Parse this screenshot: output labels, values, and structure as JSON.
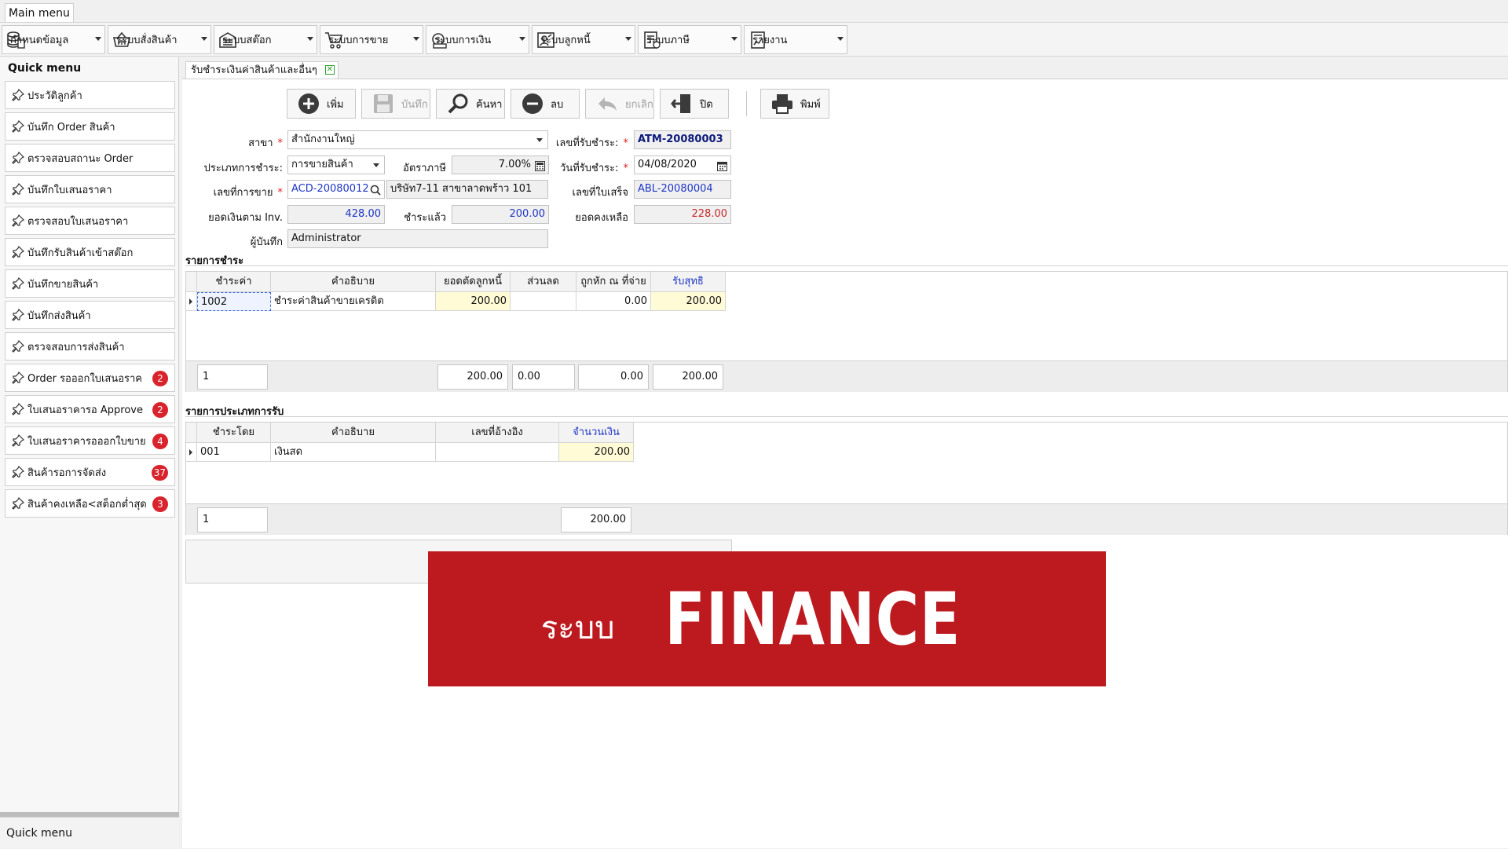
{
  "window": {
    "main_menu_tab": "Main menu"
  },
  "menubar": {
    "items": [
      {
        "label": "กำหนดข้อมูล",
        "icon": "database-icon"
      },
      {
        "label": "ระบบสั่งสินค้า",
        "icon": "basket-icon"
      },
      {
        "label": "ระบบสต๊อก",
        "icon": "warehouse-icon"
      },
      {
        "label": "ระบบการขาย",
        "icon": "cart-icon"
      },
      {
        "label": "ระบบการเงิน",
        "icon": "money-icon"
      },
      {
        "label": "ระบบลูกหนี้",
        "icon": "debtor-icon"
      },
      {
        "label": "ระบบภาษี",
        "icon": "tax-icon"
      },
      {
        "label": "รายงาน",
        "icon": "report-icon"
      }
    ]
  },
  "sidebar": {
    "title": "Quick menu",
    "footer": "Quick menu",
    "items": [
      {
        "label": "ประวัติลูกค้า",
        "badge": ""
      },
      {
        "label": "บันทึก Order สินค้า",
        "badge": ""
      },
      {
        "label": "ตรวจสอบสถานะ Order",
        "badge": ""
      },
      {
        "label": "บันทึกใบเสนอราคา",
        "badge": ""
      },
      {
        "label": "ตรวจสอบใบเสนอราคา",
        "badge": ""
      },
      {
        "label": "บันทึกรับสินค้าเข้าสต๊อก",
        "badge": ""
      },
      {
        "label": "บันทึกขายสินค้า",
        "badge": ""
      },
      {
        "label": "บันทึกส่งสินค้า",
        "badge": ""
      },
      {
        "label": "ตรวจสอบการส่งสินค้า",
        "badge": ""
      },
      {
        "label": "Order รอออกใบเสนอราค",
        "badge": "2"
      },
      {
        "label": "ใบเสนอราคารอ Approve",
        "badge": "2"
      },
      {
        "label": "ใบเสนอราคารอออกใบขาย",
        "badge": "4"
      },
      {
        "label": "สินค้ารอการจัดส่ง",
        "badge": "37"
      },
      {
        "label": "สินค้าคงเหลือ<สต็อกต่ำสุด",
        "badge": "3"
      }
    ]
  },
  "document_tab": {
    "title": "รับชำระเงินค่าสินค้าและอื่นๆ"
  },
  "toolbar": {
    "add": "เพิ่ม",
    "save": "บันทึก",
    "search": "ค้นหา",
    "delete": "ลบ",
    "cancel": "ยกเลิก",
    "close": "ปิด",
    "print": "พิมพ์"
  },
  "form": {
    "branch_label": "สาขา",
    "branch_value": "สำนักงานใหญ่",
    "receipt_no_label": "เลขที่รับชำระ:",
    "receipt_no_value": "ATM-20080003",
    "payment_type_label": "ประเภทการชำระ:",
    "payment_type_value": "การขายสินค้า",
    "tax_rate_label": "อัตราภาษี",
    "tax_rate_value": "7.00%",
    "receipt_date_label": "วันที่รับชำระ:",
    "receipt_date_value": "04/08/2020",
    "sale_no_label": "เลขที่การขาย",
    "sale_no_value": "ACD-20080012",
    "customer_value": "บริษัท7-11 สาขาลาดพร้าว 101",
    "receipt_doc_label": "เลขที่ใบเสร็จ",
    "receipt_doc_value": "ABL-20080004",
    "inv_amount_label": "ยอดเงินตาม Inv.",
    "inv_amount_value": "428.00",
    "paid_label": "ชำระแล้ว",
    "paid_value": "200.00",
    "balance_label": "ยอดคงเหลือ",
    "balance_value": "228.00",
    "recorder_label": "ผู้บันทึก",
    "recorder_value": "Administrator"
  },
  "payment_items": {
    "section_title": "รายการชำระ",
    "columns": [
      "ชำระค่า",
      "คำอธิบาย",
      "ยอดตัดลูกหนี้",
      "ส่วนลด",
      "ถูกหัก ณ ที่จ่าย",
      "รับสุทธิ"
    ],
    "rows": [
      {
        "code": "1002",
        "desc": "ชำระค่าสินค้าขายเครดิต",
        "debt": "200.00",
        "discount": "",
        "wht": "0.00",
        "net": "200.00"
      }
    ],
    "footer": {
      "count": "1",
      "debt": "200.00",
      "discount": "0.00",
      "wht": "0.00",
      "net": "200.00"
    }
  },
  "receipt_types": {
    "section_title": "รายการประเภทการรับ",
    "columns": [
      "ชำระโดย",
      "คำอธิบาย",
      "เลขที่อ้างอิง",
      "จำนวนเงิน"
    ],
    "rows": [
      {
        "code": "001",
        "desc": "เงินสด",
        "ref": "",
        "amount": "200.00"
      }
    ],
    "footer": {
      "count": "1",
      "amount": "200.00"
    }
  },
  "banner": {
    "small": "ระบบ",
    "big": "FINANCE"
  },
  "colors": {
    "accent_red": "#bd1a1f",
    "badge_red": "#d9232d",
    "link_blue": "#1d35c6",
    "highlight_yellow": "#fffbd6"
  }
}
